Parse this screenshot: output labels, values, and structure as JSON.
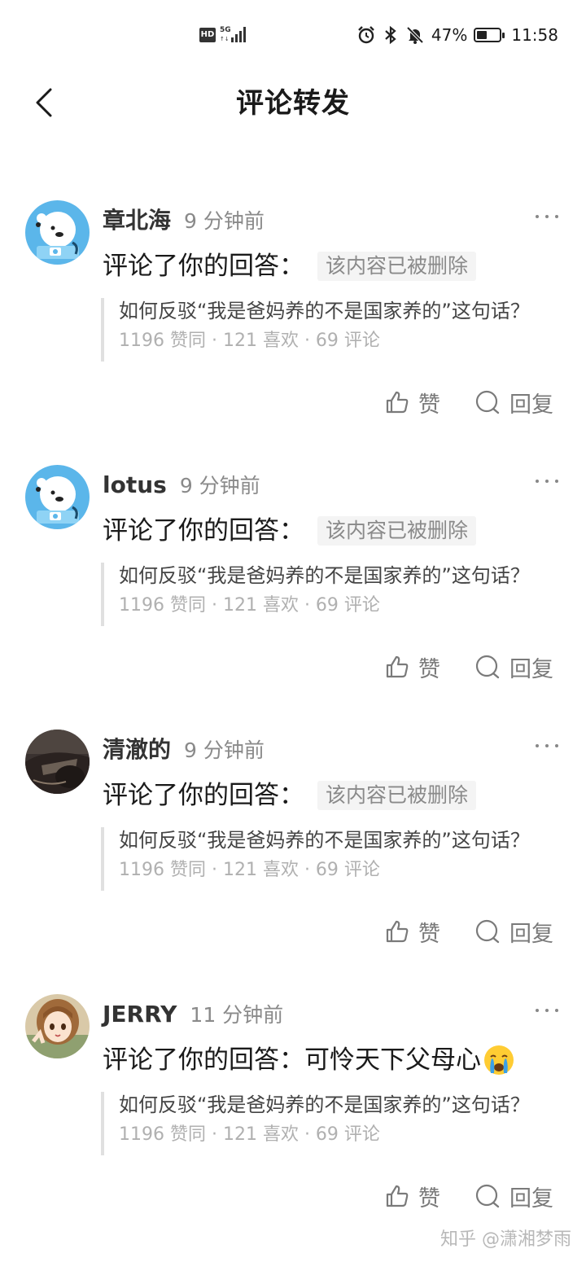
{
  "status_bar": {
    "hd": "HD",
    "network": "5G",
    "battery_text": "47%",
    "battery_level": 0.47,
    "time": "11:58",
    "icons": [
      "alarm-icon",
      "bluetooth-icon",
      "mute-icon"
    ]
  },
  "nav": {
    "back_icon": "chevron-left-icon",
    "title": "评论转发"
  },
  "feed": [
    {
      "user": "章北海",
      "time": "9 分钟前",
      "action": "评论了你的回答：",
      "comment": "该内容已被删除",
      "comment_deleted": true,
      "avatar": "polar-bear-avatar",
      "quote_title": "如何反驳“我是爸妈养的不是国家养的”这句话？",
      "quote_stats": "1196 赞同 · 121 喜欢 · 69 评论",
      "like_label": "赞",
      "reply_label": "回复"
    },
    {
      "user": "lotus",
      "time": "9 分钟前",
      "action": "评论了你的回答：",
      "comment": "该内容已被删除",
      "comment_deleted": true,
      "avatar": "polar-bear-avatar",
      "quote_title": "如何反驳“我是爸妈养的不是国家养的”这句话？",
      "quote_stats": "1196 赞同 · 121 喜欢 · 69 评论",
      "like_label": "赞",
      "reply_label": "回复"
    },
    {
      "user": "清澈的",
      "time": "9 分钟前",
      "action": "评论了你的回答：",
      "comment": "该内容已被删除",
      "comment_deleted": true,
      "avatar": "photo-avatar",
      "quote_title": "如何反驳“我是爸妈养的不是国家养的”这句话？",
      "quote_stats": "1196 赞同 · 121 喜欢 · 69 评论",
      "like_label": "赞",
      "reply_label": "回复"
    },
    {
      "user": "JERRY",
      "time": "11 分钟前",
      "action": "评论了你的回答：",
      "comment": "可怜天下父母心",
      "comment_deleted": false,
      "avatar": "anime-girl-avatar",
      "emoji": "crying-face-icon",
      "quote_title": "如何反驳“我是爸妈养的不是国家养的”这句话？",
      "quote_stats": "1196 赞同 · 121 喜欢 · 69 评论",
      "like_label": "赞",
      "reply_label": "回复"
    }
  ],
  "watermark": "知乎 @潇湘梦雨",
  "colors": {
    "text_primary": "#1a1a1a",
    "text_secondary": "#8a8a8a",
    "deleted_bg": "#f4f4f4",
    "quote_bar": "#e0e0e0",
    "avatar_blue": "#5bb6ea"
  }
}
